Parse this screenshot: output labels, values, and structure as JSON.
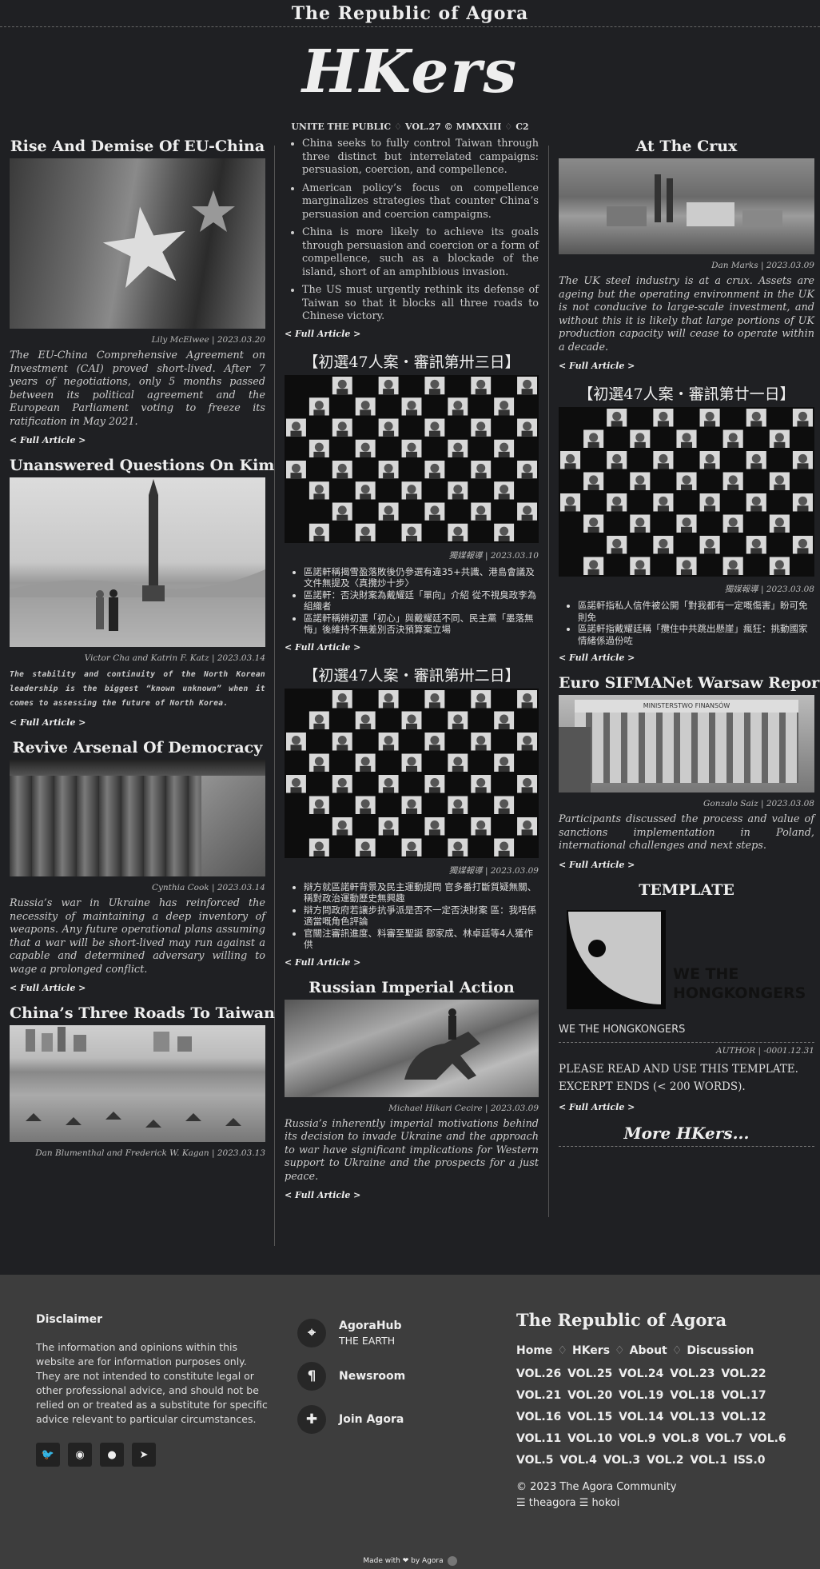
{
  "site": {
    "title": "The Republic of Agora",
    "masthead": "HKers",
    "tagline": {
      "a": "UNITE THE PUBLIC",
      "b": "VOL.27",
      "c": "MMXXIII",
      "d": "C2",
      "sep": "♢",
      "copy": "©"
    }
  },
  "col1": [
    {
      "title": "Rise And Demise Of EU-China",
      "byline": "Lily McElwee | 2023.03.20",
      "excerpt": "The EU-China Comprehensive Agreement on Investment (CAI) proved short-lived. After 7 years of negotiations, only 5 months passed between its political agreement and the European Parliament voting to freeze its ratification in May 2021.",
      "more": "< Full Article >"
    },
    {
      "title": "Unanswered Questions On Kim",
      "byline": "Victor Cha and Katrin F. Katz | 2023.03.14",
      "excerpt": "The stability and continuity of the North Korean leadership is the biggest “known unknown” when it comes to assessing the future of North Korea.",
      "more": "< Full Article >"
    },
    {
      "title": "Revive Arsenal Of Democracy",
      "byline": "Cynthia Cook | 2023.03.14",
      "excerpt": "Russia’s war in Ukraine has reinforced the necessity of maintaining a deep inventory of weapons. Any future operational plans assuming that a war will be short-lived may run against a capable and determined adversary willing to wage a prolonged conflict.",
      "more": "< Full Article >"
    },
    {
      "title": "China’s Three Roads To Taiwan",
      "byline": "Dan Blumenthal and Frederick W. Kagan | 2023.03.13"
    }
  ],
  "col2": {
    "bullets": [
      "China seeks to fully control Taiwan through three distinct but interrelated campaigns: persuasion, coercion, and compellence.",
      "American policy’s focus on compellence marginalizes strategies that counter China’s persuasion and coercion campaigns.",
      "China is more likely to achieve its goals through persuasion and coercion or a form of compellence, such as a blockade of the island, short of an amphibious invasion.",
      "The US must urgently rethink its defense of Taiwan so that it blocks all three roads to Chinese victory."
    ],
    "more0": "< Full Article >",
    "a1": {
      "title": "【初選47人案・審訊第卅三日】",
      "byline": "獨媒報導 | 2023.03.10",
      "bullets": [
        "區諾軒稱揭雪盈落敗後仍參選有違35+共識、港島會議及文件無提及〈真攬炒十步〉",
        "區諾軒：否決財案為戴耀廷「單向」介紹 從不視臭政李為組織者",
        "區諾軒稱辨初選「初心」與戴耀廷不同、民主黨「墨落無悔」後維持不無差別否決預算案立場"
      ],
      "more": "< Full Article >"
    },
    "a2": {
      "title": "【初選47人案・審訊第卅二日】",
      "byline": "獨媒報導 | 2023.03.09",
      "bullets": [
        "辯方就區諾軒背景及民主運動提問 官多番打斷質疑無關、稱對政治運動歷史無興趣",
        "辯方問政府若讓步抗爭派是否不一定否決財案 區：我唔係適當嘅角色評論",
        "官關注審訊進度、料審至聖誕 鄒家成、林卓廷等4人獲作供"
      ],
      "more": "< Full Article >"
    },
    "a3": {
      "title": "Russian Imperial Action",
      "byline": "Michael Hikari Cecire | 2023.03.09",
      "excerpt": "Russia’s inherently imperial motivations behind its decision to invade Ukraine and the approach to war have significant implications for Western support to Ukraine and the prospects for a just peace.",
      "more": "< Full Article >"
    }
  },
  "col3": {
    "a1": {
      "title": "At The Crux",
      "byline": "Dan Marks | 2023.03.09",
      "excerpt": "The UK steel industry is at a crux. Assets are ageing but the operating environment in the UK is not conducive to large-scale investment, and without this it is likely that large portions of UK production capacity will cease to operate within a decade.",
      "more": "< Full Article >"
    },
    "a2": {
      "title": "【初選47人案・審訊第廿一日】",
      "byline": "獨媒報導 | 2023.03.08",
      "bullets": [
        "區諾軒指私人信件被公開「對我都有一定嘅傷害」盼可免則免",
        "區諾軒指戴耀廷稱「攬住中共跳出懸崖」瘋狂：挑動國家情緒係過份咗"
      ],
      "more": "< Full Article >"
    },
    "a3": {
      "title": "Euro SIFMANet Warsaw Report",
      "img_caption": "MINISTERSTWO FINANSÓW",
      "byline": "Gonzalo Saiz | 2023.03.08",
      "excerpt": "Participants discussed the process and value of sanctions implementation in Poland, international challenges and next steps.",
      "more": "< Full Article >"
    },
    "tmpl": {
      "title": "TEMPLATE",
      "logo_text1": "WE THE",
      "logo_text2": "HONGKONGERS",
      "caption": "WE THE HONGKONGERS",
      "byline": "AUTHOR | -0001.12.31",
      "body1": "PLEASE READ AND USE THIS TEMPLATE.",
      "body2": "EXCERPT ENDS (< 200 WORDS).",
      "more": "< Full Article >"
    },
    "more_hkers": "More HKers..."
  },
  "footer": {
    "disclaimer_title": "Disclaimer",
    "disclaimer": "The information and opinions within this website are for information purposes only. They are not intended to constitute legal or other professional advice, and should not be relied on or treated as a substitute for specific advice relevant to particular circumstances.",
    "links": [
      {
        "title": "AgoraHub",
        "sub": "THE EARTH"
      },
      {
        "title": "Newsroom"
      },
      {
        "title": "Join Agora"
      }
    ],
    "brand": "The Republic of Agora",
    "nav": [
      "Home",
      "HKers",
      "About",
      "Discussion"
    ],
    "nav_sep": "♢",
    "vols": [
      "VOL.26 VOL.25 VOL.24 VOL.23 VOL.22",
      "VOL.21 VOL.20 VOL.19 VOL.18 VOL.17",
      "VOL.16 VOL.15 VOL.14 VOL.13 VOL.12",
      "VOL.11 VOL.10 VOL.9 VOL.8 VOL.7 VOL.6",
      "VOL.5 VOL.4 VOL.3 VOL.2 VOL.1 ISS.0"
    ],
    "copyright": "© 2023 The Agora Community",
    "credits": "☰ theagora ☰ hokoi",
    "made_with": "Made with ❤ by Agora"
  }
}
